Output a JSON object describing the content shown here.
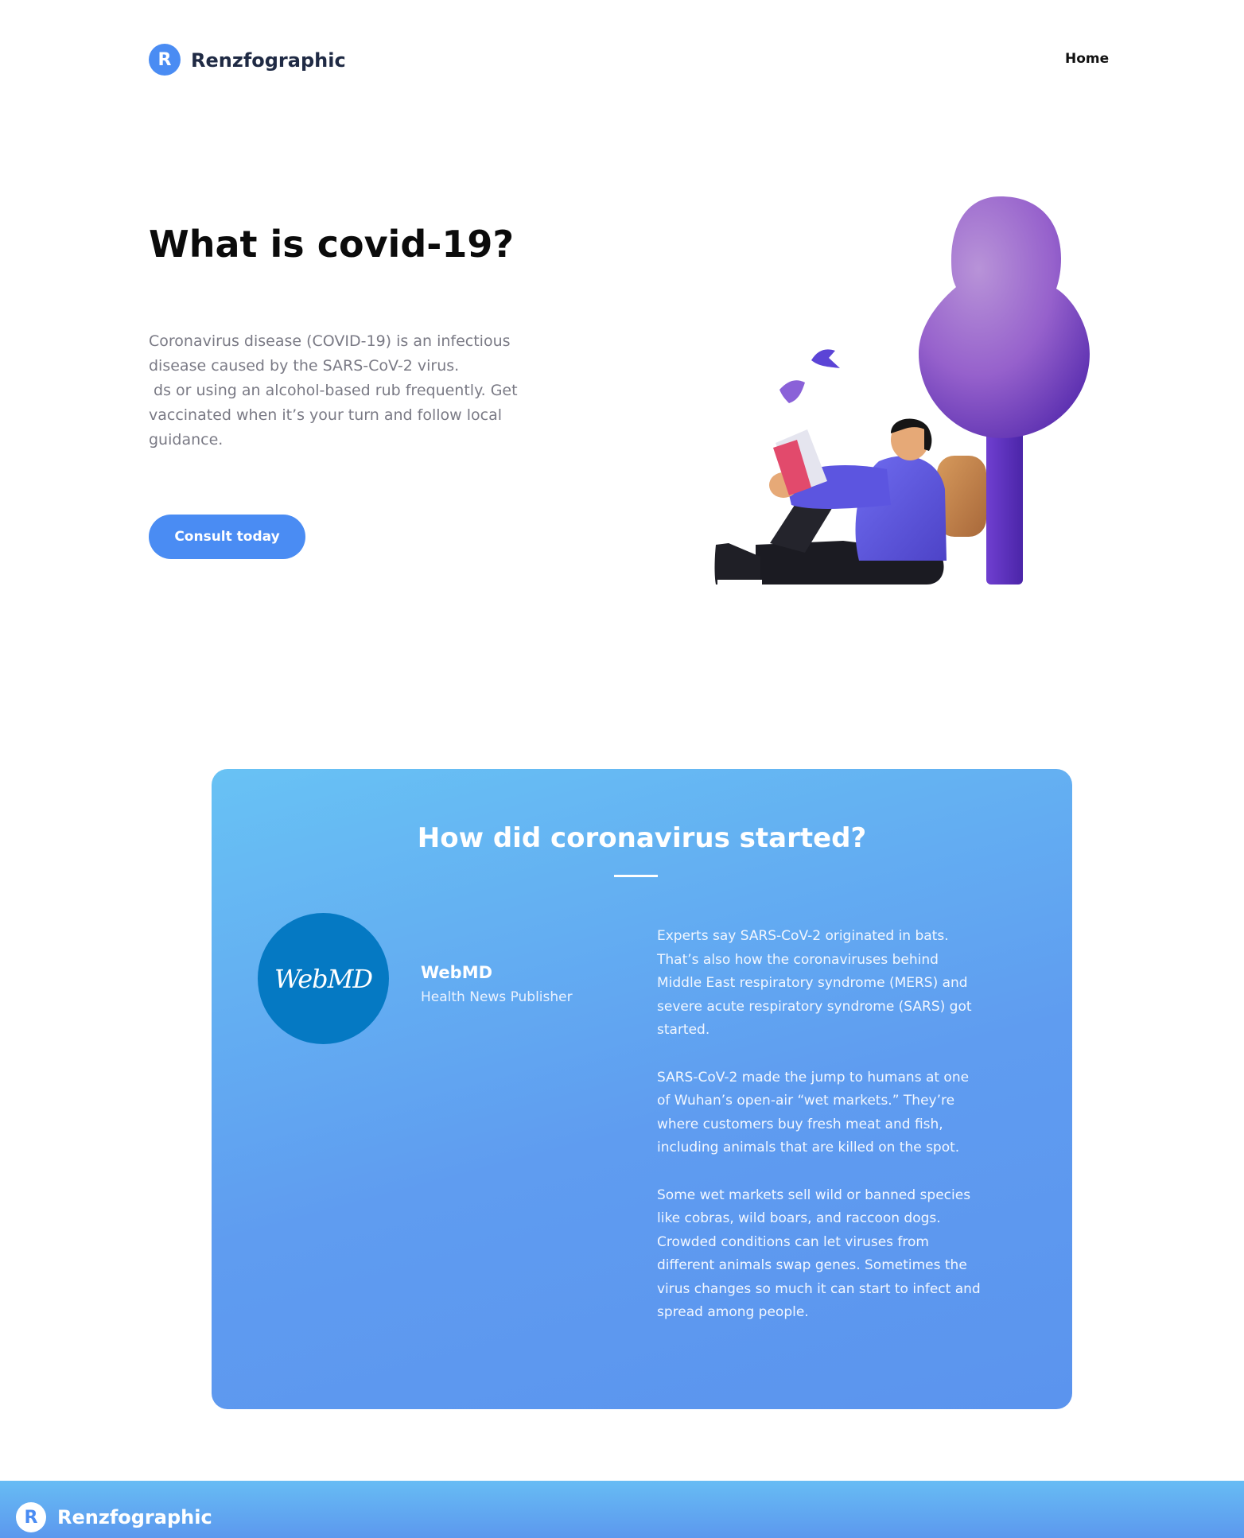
{
  "header": {
    "logo_letter": "R",
    "brand": "Renzfographic",
    "nav": [
      {
        "label": "Home"
      }
    ]
  },
  "hero": {
    "title": "What is covid-19?",
    "description_lines": [
      "Coronavirus disease (COVID-19) is an infectious",
      "disease caused by the SARS-CoV-2 virus.",
      " ds or using an alcohol-based rub frequently. Get",
      "vaccinated when it’s your turn and follow local",
      "guidance."
    ],
    "cta_label": "Consult today",
    "illustration_icon": "person-reading-under-tree-illustration"
  },
  "origin_section": {
    "title": "How did coronavirus started?",
    "source": {
      "logo_text": "WebMD",
      "name": "WebMD",
      "role": "Health News Publisher"
    },
    "paragraphs": [
      {
        "lines": [
          "Experts say SARS-CoV-2 originated in bats.",
          "That’s also how the coronaviruses behind",
          "Middle East respiratory syndrome (MERS) and",
          "severe acute respiratory syndrome (SARS) got",
          "started."
        ]
      },
      {
        "lines": [
          "SARS-CoV-2 made the jump to humans at one",
          "of Wuhan’s open-air “wet markets.” They’re",
          "where customers buy fresh meat and fish,",
          "including animals that are killed on the spot."
        ]
      },
      {
        "lines": [
          "Some wet markets sell wild or banned species",
          "like cobras, wild boars, and raccoon dogs.",
          "Crowded conditions can let viruses from",
          "different animals swap genes. Sometimes the",
          "virus changes so much it can start to infect and",
          "spread among people."
        ]
      }
    ]
  },
  "footer": {
    "logo_letter": "R",
    "brand": "Renzfographic"
  },
  "colors": {
    "accent": "#4a8cf3",
    "card_gradient_top": "#68c2f4",
    "card_gradient_bottom": "#5b94ee",
    "webmd_blue": "#0579c3"
  }
}
